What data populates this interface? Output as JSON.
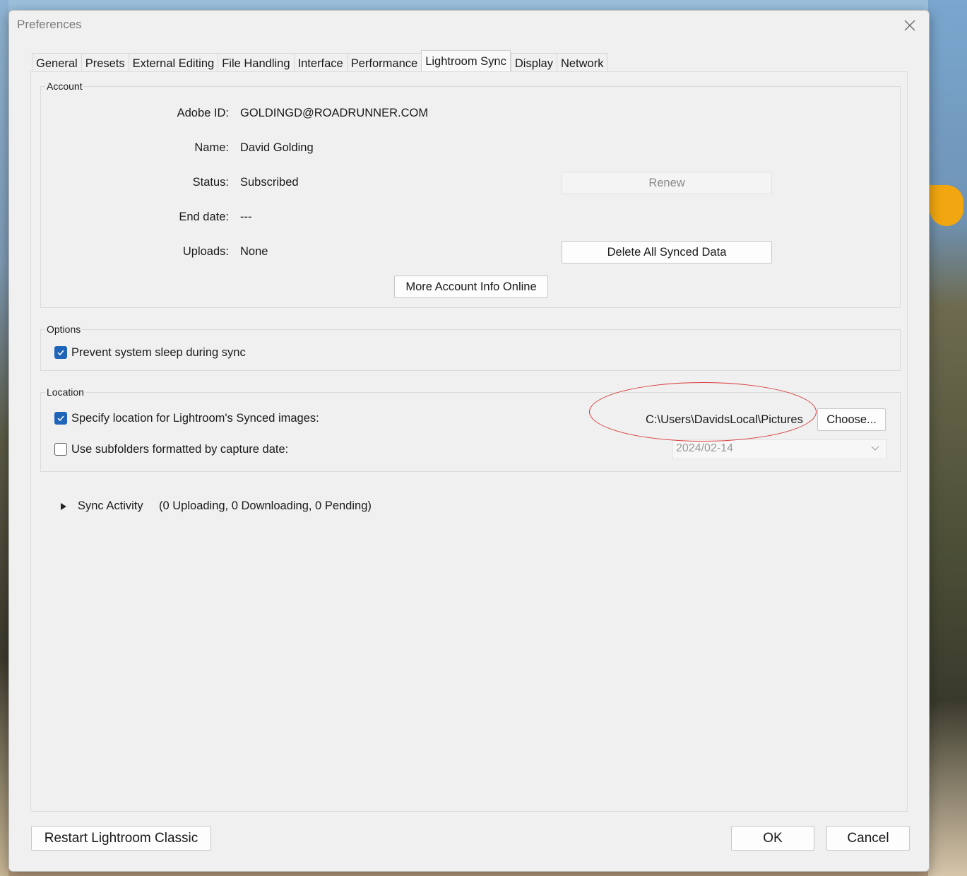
{
  "window": {
    "title": "Preferences"
  },
  "tabs": [
    {
      "label": "General"
    },
    {
      "label": "Presets"
    },
    {
      "label": "External Editing"
    },
    {
      "label": "File Handling"
    },
    {
      "label": "Interface"
    },
    {
      "label": "Performance"
    },
    {
      "label": "Lightroom Sync",
      "active": true
    },
    {
      "label": "Display"
    },
    {
      "label": "Network"
    }
  ],
  "account": {
    "legend": "Account",
    "adobe_id_label": "Adobe ID:",
    "adobe_id": "GOLDINGD@ROADRUNNER.COM",
    "name_label": "Name:",
    "name": "David Golding",
    "status_label": "Status:",
    "status": "Subscribed",
    "end_date_label": "End date:",
    "end_date": "---",
    "uploads_label": "Uploads:",
    "uploads": "None",
    "renew_button": "Renew",
    "delete_button": "Delete All Synced Data",
    "more_info_button": "More Account Info Online"
  },
  "options": {
    "legend": "Options",
    "prevent_sleep_label": "Prevent system sleep during sync",
    "prevent_sleep_checked": true
  },
  "location": {
    "legend": "Location",
    "specify_label": "Specify location for Lightroom's Synced images:",
    "specify_checked": true,
    "path": "C:\\Users\\DavidsLocal\\Pictures",
    "choose_button": "Choose...",
    "subfolders_label": "Use subfolders formatted by capture date:",
    "subfolders_checked": false,
    "date_format_value": "2024/02-14"
  },
  "sync_activity": {
    "label": "Sync Activity",
    "summary": "(0 Uploading, 0 Downloading, 0 Pending)"
  },
  "footer": {
    "restart_button": "Restart Lightroom Classic",
    "ok_button": "OK",
    "cancel_button": "Cancel"
  },
  "colors": {
    "accent": "#1f64b8",
    "annotation": "#d83a3a"
  }
}
